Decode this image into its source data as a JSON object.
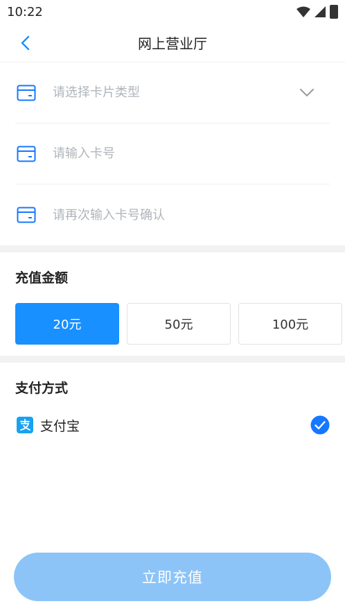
{
  "status_bar": {
    "time": "10:22"
  },
  "header": {
    "title": "网上营业厅"
  },
  "form": {
    "card_type": {
      "placeholder": "请选择卡片类型"
    },
    "card_number": {
      "placeholder": "请输入卡号"
    },
    "card_confirm": {
      "placeholder": "请再次输入卡号确认"
    }
  },
  "recharge": {
    "title": "充值金额",
    "options": [
      "20元",
      "50元",
      "100元"
    ],
    "selected_index": 0
  },
  "payment": {
    "title": "支付方式",
    "method": "支付宝",
    "method_icon": "alipay-icon",
    "selected": true
  },
  "submit": {
    "label": "立即充值"
  },
  "colors": {
    "primary": "#1890ff",
    "primary_disabled": "#8cc4f8",
    "icon_blue": "#1677ff",
    "placeholder": "#b0b5bb"
  }
}
